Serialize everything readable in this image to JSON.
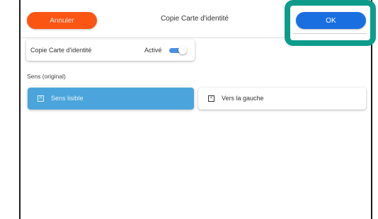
{
  "header": {
    "cancel_label": "Annuler",
    "title": "Copie Carte d'identité",
    "ok_label": "OK"
  },
  "setting": {
    "label": "Copie Carte d'identité",
    "state_label": "Activé",
    "enabled": true
  },
  "orientation": {
    "section_label": "Sens (original)",
    "options": [
      {
        "label": "Sens lisible",
        "icon": "portrait-page-icon",
        "selected": true
      },
      {
        "label": "Vers la gauche",
        "icon": "rotate-left-page-icon",
        "selected": false
      }
    ]
  },
  "colors": {
    "cancel": "#fb5514",
    "ok": "#1a6fe0",
    "highlight": "#0d9c8c",
    "selected_option": "#4ba5dc",
    "toggle_on": "#4a8fe0"
  }
}
